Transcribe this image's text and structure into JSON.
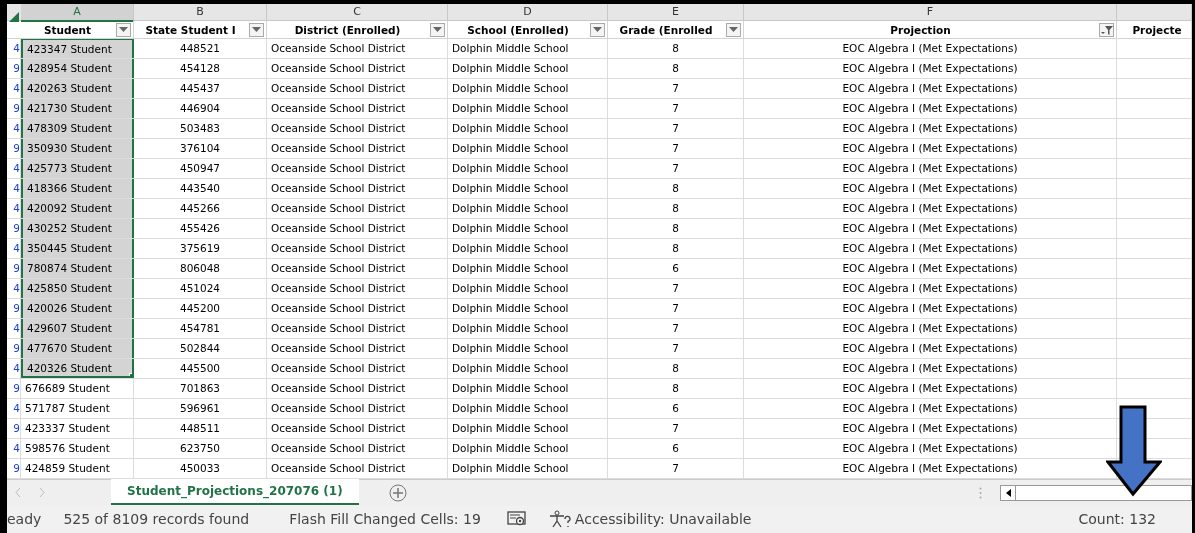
{
  "columns": [
    {
      "letter": "A",
      "header": "Student",
      "kind": "dropdown",
      "selected": true
    },
    {
      "letter": "B",
      "header": "State Student I",
      "kind": "dropdown",
      "selected": false
    },
    {
      "letter": "C",
      "header": "District (Enrolled)",
      "kind": "dropdown",
      "selected": false
    },
    {
      "letter": "D",
      "header": "School (Enrolled)",
      "kind": "dropdown",
      "selected": false
    },
    {
      "letter": "E",
      "header": "Grade (Enrolled",
      "kind": "dropdown",
      "selected": false
    },
    {
      "letter": "F",
      "header": "Projection",
      "kind": "filtered",
      "selected": false
    },
    {
      "header": "Projecte",
      "kind": "plain",
      "selected": false
    }
  ],
  "rows": [
    {
      "link": "4",
      "selected": true,
      "cells": [
        "423347 Student",
        "448521",
        "Oceanside School District",
        "Dolphin Middle School",
        "8",
        "EOC Algebra I (Met Expectations)"
      ]
    },
    {
      "link": "9",
      "selected": true,
      "cells": [
        "428954 Student",
        "454128",
        "Oceanside School District",
        "Dolphin Middle School",
        "8",
        "EOC Algebra I (Met Expectations)"
      ]
    },
    {
      "link": "4",
      "selected": true,
      "cells": [
        "420263 Student",
        "445437",
        "Oceanside School District",
        "Dolphin Middle School",
        "7",
        "EOC Algebra I (Met Expectations)"
      ]
    },
    {
      "link": "9",
      "selected": true,
      "cells": [
        "421730 Student",
        "446904",
        "Oceanside School District",
        "Dolphin Middle School",
        "7",
        "EOC Algebra I (Met Expectations)"
      ]
    },
    {
      "link": "4",
      "selected": true,
      "cells": [
        "478309 Student",
        "503483",
        "Oceanside School District",
        "Dolphin Middle School",
        "7",
        "EOC Algebra I (Met Expectations)"
      ]
    },
    {
      "link": "9",
      "selected": true,
      "cells": [
        "350930 Student",
        "376104",
        "Oceanside School District",
        "Dolphin Middle School",
        "7",
        "EOC Algebra I (Met Expectations)"
      ]
    },
    {
      "link": "4",
      "selected": true,
      "cells": [
        "425773 Student",
        "450947",
        "Oceanside School District",
        "Dolphin Middle School",
        "7",
        "EOC Algebra I (Met Expectations)"
      ]
    },
    {
      "link": "4",
      "selected": true,
      "cells": [
        "418366 Student",
        "443540",
        "Oceanside School District",
        "Dolphin Middle School",
        "8",
        "EOC Algebra I (Met Expectations)"
      ]
    },
    {
      "link": "4",
      "selected": true,
      "cells": [
        "420092 Student",
        "445266",
        "Oceanside School District",
        "Dolphin Middle School",
        "8",
        "EOC Algebra I (Met Expectations)"
      ]
    },
    {
      "link": "9",
      "selected": true,
      "cells": [
        "430252 Student",
        "455426",
        "Oceanside School District",
        "Dolphin Middle School",
        "8",
        "EOC Algebra I (Met Expectations)"
      ]
    },
    {
      "link": "4",
      "selected": true,
      "cells": [
        "350445 Student",
        "375619",
        "Oceanside School District",
        "Dolphin Middle School",
        "8",
        "EOC Algebra I (Met Expectations)"
      ]
    },
    {
      "link": "9",
      "selected": true,
      "cells": [
        "780874 Student",
        "806048",
        "Oceanside School District",
        "Dolphin Middle School",
        "6",
        "EOC Algebra I (Met Expectations)"
      ]
    },
    {
      "link": "4",
      "selected": true,
      "cells": [
        "425850 Student",
        "451024",
        "Oceanside School District",
        "Dolphin Middle School",
        "7",
        "EOC Algebra I (Met Expectations)"
      ]
    },
    {
      "link": "9",
      "selected": true,
      "cells": [
        "420026 Student",
        "445200",
        "Oceanside School District",
        "Dolphin Middle School",
        "7",
        "EOC Algebra I (Met Expectations)"
      ]
    },
    {
      "link": "4",
      "selected": true,
      "cells": [
        "429607 Student",
        "454781",
        "Oceanside School District",
        "Dolphin Middle School",
        "7",
        "EOC Algebra I (Met Expectations)"
      ]
    },
    {
      "link": "9",
      "selected": true,
      "cells": [
        "477670 Student",
        "502844",
        "Oceanside School District",
        "Dolphin Middle School",
        "7",
        "EOC Algebra I (Met Expectations)"
      ]
    },
    {
      "link": "4",
      "selected": true,
      "cells": [
        "420326 Student",
        "445500",
        "Oceanside School District",
        "Dolphin Middle School",
        "8",
        "EOC Algebra I (Met Expectations)"
      ]
    },
    {
      "link": "9",
      "selected": false,
      "cells": [
        "676689 Student",
        "701863",
        "Oceanside School District",
        "Dolphin Middle School",
        "8",
        "EOC Algebra I (Met Expectations)"
      ]
    },
    {
      "link": "4",
      "selected": false,
      "cells": [
        "571787 Student",
        "596961",
        "Oceanside School District",
        "Dolphin Middle School",
        "6",
        "EOC Algebra I (Met Expectations)"
      ]
    },
    {
      "link": "9",
      "selected": false,
      "cells": [
        "423337 Student",
        "448511",
        "Oceanside School District",
        "Dolphin Middle School",
        "7",
        "EOC Algebra I (Met Expectations)"
      ]
    },
    {
      "link": "4",
      "selected": false,
      "cells": [
        "598576 Student",
        "623750",
        "Oceanside School District",
        "Dolphin Middle School",
        "6",
        "EOC Algebra I (Met Expectations)"
      ]
    },
    {
      "link": "9",
      "selected": false,
      "cells": [
        "424859 Student",
        "450033",
        "Oceanside School District",
        "Dolphin Middle School",
        "7",
        "EOC Algebra I (Met Expectations)"
      ]
    }
  ],
  "sheet_tabs": [
    {
      "label": "Student_Projections_207076 (1)",
      "selected": true
    }
  ],
  "status_bar": {
    "mode": "eady",
    "records": "525 of 8109 records found",
    "flash_fill": "Flash Fill Changed Cells: 19",
    "accessibility": "Accessibility: Unavailable",
    "count": "Count: 132"
  }
}
